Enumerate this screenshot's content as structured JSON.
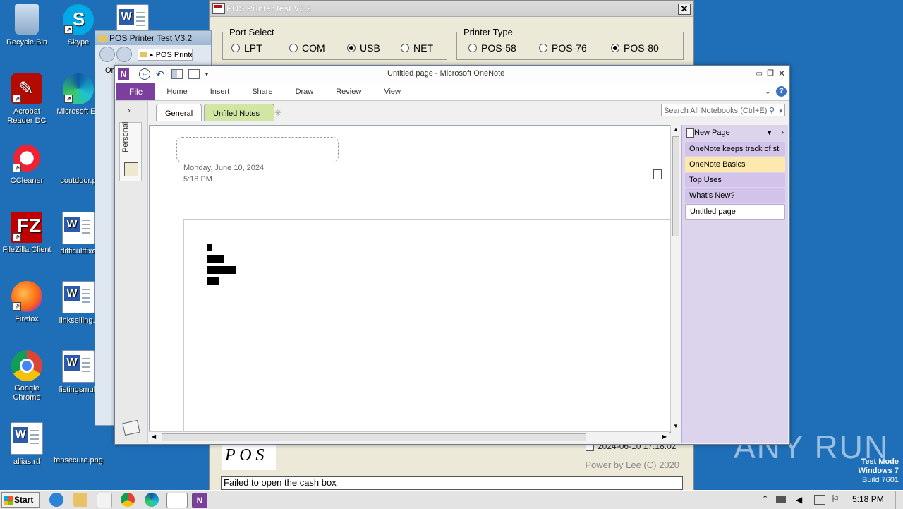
{
  "desktop": {
    "icons": [
      {
        "label": "Recycle Bin"
      },
      {
        "label": "Skype"
      },
      {
        "label": "Acrobat\nReader DC"
      },
      {
        "label": "Microsoft Ed"
      },
      {
        "label": "CCleaner"
      },
      {
        "label": "coutdoor.p"
      },
      {
        "label": "FileZilla Client"
      },
      {
        "label": "difficultfixe"
      },
      {
        "label": "Firefox"
      },
      {
        "label": "linkselling.r"
      },
      {
        "label": "Google\nChrome"
      },
      {
        "label": "listingsmult"
      },
      {
        "label": "allias.rtf"
      },
      {
        "label": "tensecure.png"
      }
    ],
    "watermark": "ANY RUN",
    "test_mode": {
      "line1": "Test Mode",
      "line2": "Windows 7",
      "line3": "Build 7601"
    }
  },
  "pos_window": {
    "title": "POS Printer test V3.2",
    "port_select": {
      "caption": "Port Select",
      "options": [
        "LPT",
        "COM",
        "USB",
        "NET"
      ],
      "selected": "USB"
    },
    "printer_type": {
      "caption": "Printer Type",
      "options": [
        "POS-58",
        "POS-76",
        "POS-80"
      ],
      "selected": "POS-80"
    },
    "logo_text": "P O S",
    "timestamp": "2024-06-10 17:18:02",
    "credit": "Power by Lee (C) 2020",
    "status": "Failed to open the cash box"
  },
  "explorer_window": {
    "title": "POS Printer Test V3.2",
    "address": "POS Printe",
    "menu_fragment": "Or"
  },
  "onenote": {
    "title": "Untitled page  -  Microsoft OneNote",
    "ribbon": {
      "file": "File",
      "tabs": [
        "Home",
        "Insert",
        "Share",
        "Draw",
        "Review",
        "View"
      ]
    },
    "notebook_tabs": [
      "General",
      "Unfiled Notes"
    ],
    "search_placeholder": "Search All Notebooks (Ctrl+E)",
    "notebook_name": "Personal",
    "page_date": "Monday, June 10, 2024",
    "page_time": "5:18 PM",
    "new_page": "New Page",
    "pages": [
      {
        "label": "OneNote keeps track of st",
        "active": false
      },
      {
        "label": "OneNote Basics",
        "active": false,
        "highlight": true
      },
      {
        "label": "Top Uses",
        "active": false
      },
      {
        "label": "What's New?",
        "active": false
      },
      {
        "label": "Untitled page",
        "active": true
      }
    ]
  },
  "taskbar": {
    "start": "Start",
    "clock": "5:18 PM"
  }
}
